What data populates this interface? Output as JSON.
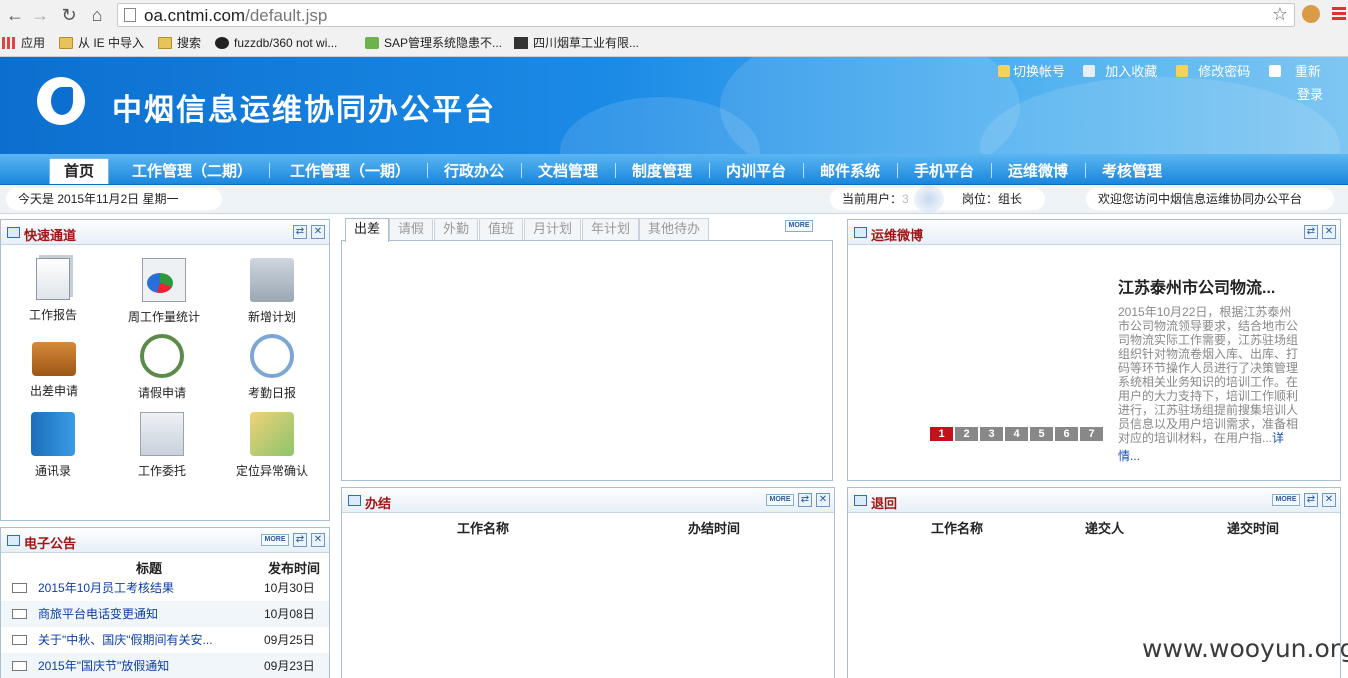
{
  "browser": {
    "url_host": "oa.cntmi.com",
    "url_path": "/default.jsp",
    "bookmarks": [
      "应用",
      "从 IE 中导入",
      "搜索",
      "fuzzdb/360 not wi...",
      "SAP管理系统隐患不...",
      "四川烟草工业有限..."
    ]
  },
  "header": {
    "site_title": "中烟信息运维协同办公平台",
    "top_links": [
      "切换帐号",
      "加入收藏",
      "修改密码",
      "重新",
      "登录"
    ]
  },
  "nav": {
    "home": "首页",
    "items": [
      "工作管理（二期）",
      "工作管理（一期）",
      "行政办公",
      "文档管理",
      "制度管理",
      "内训平台",
      "邮件系统",
      "手机平台",
      "运维微博",
      "考核管理"
    ]
  },
  "infobar": {
    "date": "今天是  2015年11月2日  星期一",
    "current_user_label": "当前用户：",
    "current_user_partial": "3",
    "position": "岗位：组长",
    "welcome": "欢迎您访问中烟信息运维协同办公平台"
  },
  "quick": {
    "title": "快速通道",
    "items": [
      "工作报告",
      "周工作量统计",
      "新增计划",
      "出差申请",
      "请假申请",
      "考勤日报",
      "通讯录",
      "工作委托",
      "定位异常确认"
    ]
  },
  "tabs": {
    "items": [
      "出差",
      "请假",
      "外勤",
      "值班",
      "月计划",
      "年计划",
      "其他待办"
    ],
    "more": "MORE"
  },
  "weibo": {
    "title": "运维微博",
    "headline": "江苏泰州市公司物流...",
    "body_lines": [
      "2015年10月22日，根据江苏泰州",
      "市公司物流领导要求，结合地市公",
      "司物流实际工作需要，江苏驻场组",
      "组织针对物流卷烟入库、出库、打",
      "码等环节操作人员进行了决策管理",
      "系统相关业务知识的培训工作。在",
      "用户的大力支持下，培训工作顺利",
      "进行，江苏驻场组提前搜集培训人",
      "员信息以及用户培训需求，准备相",
      "对应的培训材料，在用户指..."
    ],
    "detail_link_a": "详",
    "detail_link_b": "情...",
    "pages": [
      "1",
      "2",
      "3",
      "4",
      "5",
      "6",
      "7"
    ]
  },
  "notice": {
    "title": "电子公告",
    "more": "MORE",
    "col_title": "标题",
    "col_date": "发布时间",
    "rows": [
      {
        "title": "2015年10月员工考核结果",
        "date": "10月30日"
      },
      {
        "title": "商旅平台电话变更通知",
        "date": "10月08日"
      },
      {
        "title": "关于\"中秋、国庆\"假期间有关安...",
        "date": "09月25日"
      },
      {
        "title": "2015年\"国庆节\"放假通知",
        "date": "09月23日"
      }
    ]
  },
  "done": {
    "title": "办结",
    "more": "MORE",
    "col_name": "工作名称",
    "col_time": "办结时间"
  },
  "returned": {
    "title": "退回",
    "more": "MORE",
    "col_name": "工作名称",
    "col_sender": "递交人",
    "col_time": "递交时间"
  },
  "watermark": "www.wooyun.org"
}
